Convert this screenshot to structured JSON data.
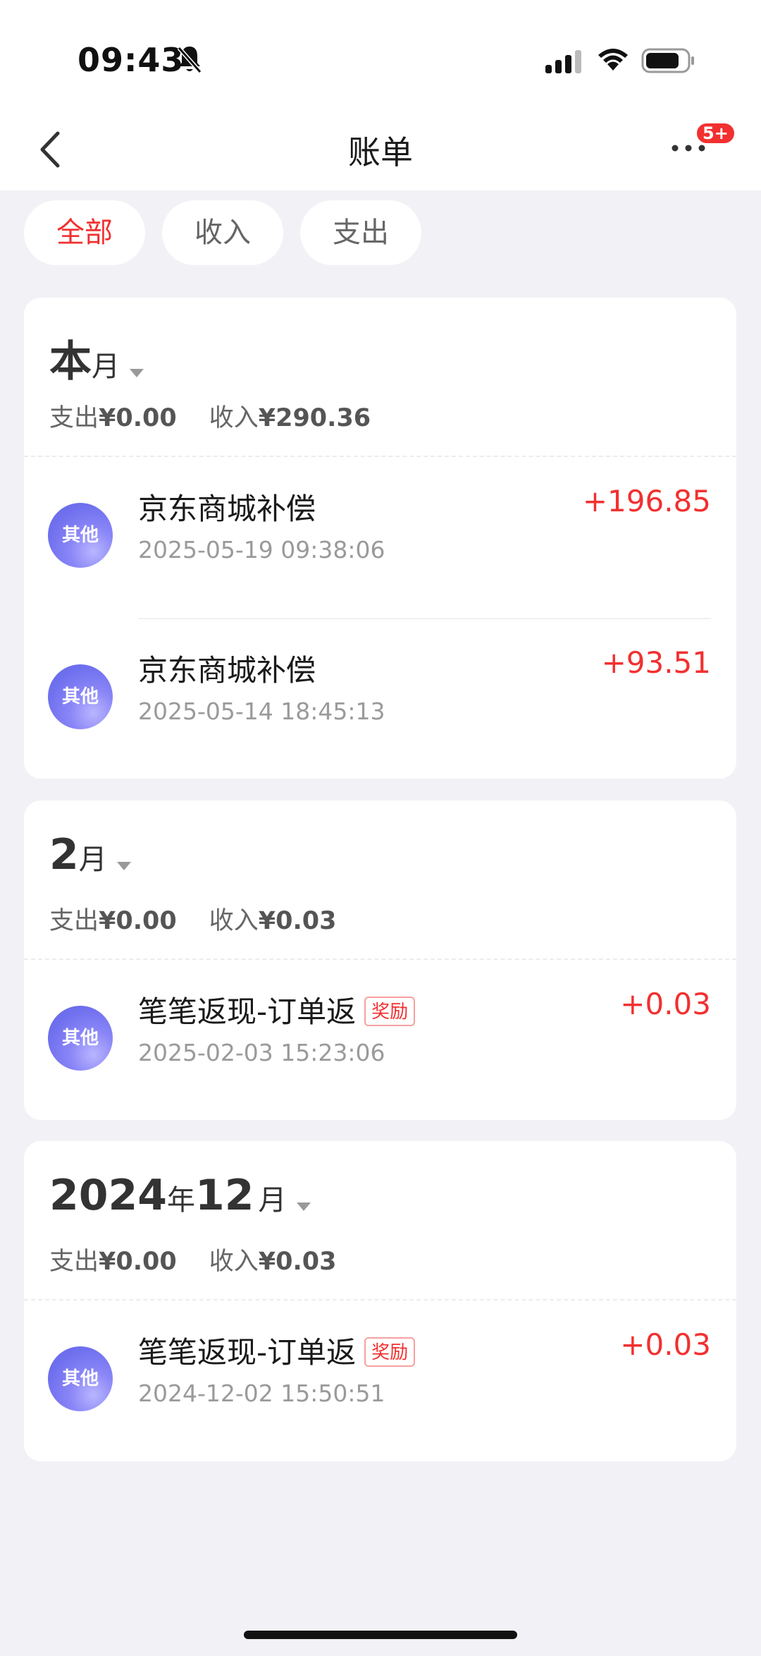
{
  "status_bar": {
    "time": "09:43",
    "icons": [
      "bell-muted-icon",
      "signal-icon",
      "wifi-icon",
      "battery-icon"
    ]
  },
  "nav": {
    "title": "账单",
    "back_icon": "chevron-left-icon",
    "more_icon": "more-dots-icon",
    "badge": "5+"
  },
  "tabs": [
    {
      "label": "全部",
      "active": true
    },
    {
      "label": "收入",
      "active": false
    },
    {
      "label": "支出",
      "active": false
    }
  ],
  "colors": {
    "accent": "#f23030",
    "page_bg": "#f2f2f6",
    "avatar": "#6f70ee"
  },
  "sections": [
    {
      "month_main": "本",
      "month_unit": "月",
      "expense_label": "支出",
      "expense_amount": "¥0.00",
      "income_label": "收入",
      "income_amount": "¥290.36",
      "items": [
        {
          "icon_label": "其他",
          "title": "京东商城补偿",
          "time": "2025-05-19 09:38:06",
          "amount": "+196.85"
        },
        {
          "icon_label": "其他",
          "title": "京东商城补偿",
          "time": "2025-05-14 18:45:13",
          "amount": "+93.51"
        }
      ]
    },
    {
      "month_main": "2",
      "month_unit": "月",
      "expense_label": "支出",
      "expense_amount": "¥0.00",
      "income_label": "收入",
      "income_amount": "¥0.03",
      "items": [
        {
          "icon_label": "其他",
          "title": "笔笔返现-订单返",
          "tag": "奖励",
          "time": "2025-02-03 15:23:06",
          "amount": "+0.03"
        }
      ]
    },
    {
      "year_main": "2024",
      "year_unit": "年",
      "month_main": "12",
      "month_unit": "月",
      "expense_label": "支出",
      "expense_amount": "¥0.00",
      "income_label": "收入",
      "income_amount": "¥0.03",
      "items": [
        {
          "icon_label": "其他",
          "title": "笔笔返现-订单返",
          "tag": "奖励",
          "time": "2024-12-02 15:50:51",
          "amount": "+0.03"
        }
      ]
    }
  ]
}
